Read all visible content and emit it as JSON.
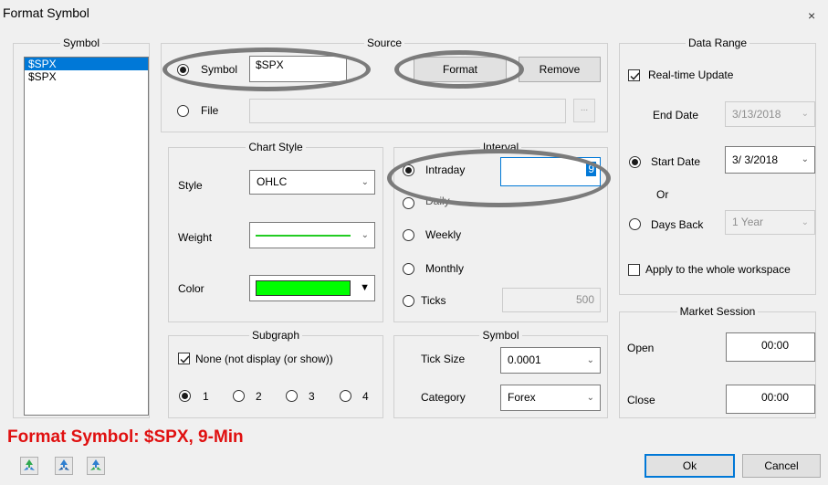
{
  "window": {
    "title": "Format Symbol",
    "close_glyph": "×"
  },
  "symbol_group": {
    "title": "Symbol",
    "items": [
      "$SPX",
      "$SPX"
    ],
    "selected_index": 0
  },
  "source": {
    "title": "Source",
    "symbol_label": "Symbol",
    "symbol_value": "$SPX",
    "format_button": "Format",
    "remove_button": "Remove",
    "file_label": "File",
    "file_value": "",
    "browse_button": "...",
    "selected": "symbol"
  },
  "chart_style": {
    "title": "Chart Style",
    "style_label": "Style",
    "style_value": "OHLC",
    "weight_label": "Weight",
    "color_label": "Color",
    "line_color": "#22cc22",
    "fill_color": "#00ff00"
  },
  "interval": {
    "title": "Interval",
    "selected": "intraday",
    "options": {
      "intraday": "Intraday",
      "daily": "Daily",
      "weekly": "Weekly",
      "monthly": "Monthly",
      "ticks": "Ticks"
    },
    "intraday_value": "9",
    "ticks_value": "500"
  },
  "subgraph": {
    "title": "Subgraph",
    "none_label": "None (not display (or show))",
    "none_checked": true,
    "options": [
      "1",
      "2",
      "3",
      "4"
    ],
    "selected_index": 0
  },
  "symbol_props": {
    "title": "Symbol",
    "tick_size_label": "Tick Size",
    "tick_size_value": "0.0001",
    "category_label": "Category",
    "category_value": "Forex"
  },
  "data_range": {
    "title": "Data Range",
    "realtime_label": "Real-time Update",
    "realtime_checked": true,
    "end_date_label": "End Date",
    "end_date_value": "3/13/2018",
    "start_date_label": "Start Date",
    "start_date_value": "3/ 3/2018",
    "or_label": "Or",
    "days_back_label": "Days Back",
    "days_back_value": "1 Year",
    "apply_label": "Apply to the whole workspace",
    "apply_checked": false
  },
  "market_session": {
    "title": "Market Session",
    "open_label": "Open",
    "open_value": "00:00",
    "close_label": "Close",
    "close_value": "00:00"
  },
  "footer": {
    "title": "Format Symbol: $SPX, 9-Min",
    "ok_button": "Ok",
    "cancel_button": "Cancel",
    "icons": [
      "green-recycle-icon",
      "blue-recycle-icon",
      "blue-green-recycle-icon"
    ]
  },
  "colors": {
    "accent": "#0078d7",
    "footer_title": "#e01010",
    "annotation_oval": "#7b7b7b"
  }
}
